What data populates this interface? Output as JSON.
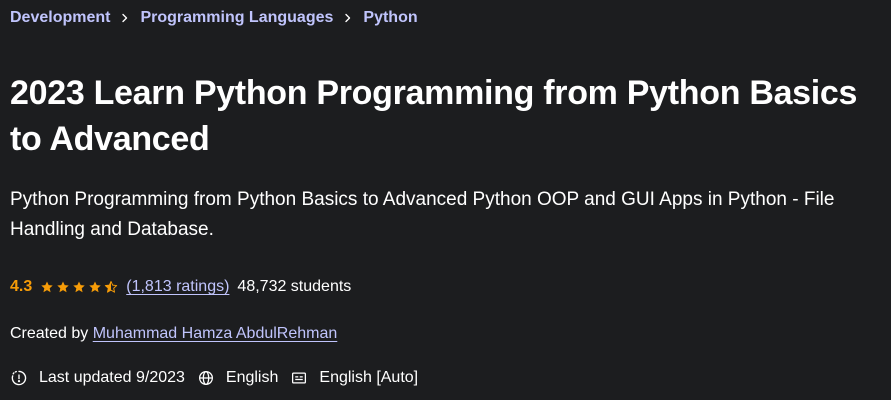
{
  "breadcrumb": {
    "items": [
      {
        "label": "Development"
      },
      {
        "label": "Programming Languages"
      },
      {
        "label": "Python"
      }
    ]
  },
  "course": {
    "title": "2023 Learn Python Programming from Python Basics to Advanced",
    "subtitle": "Python Programming from Python Basics to Advanced Python OOP and GUI Apps in Python - File Handling and Database."
  },
  "rating": {
    "value": "4.3",
    "stars": 4.3,
    "ratings_count": "(1,813 ratings)",
    "students": "48,732 students"
  },
  "creator": {
    "prefix": "Created by",
    "name": "Muhammad Hamza AbdulRehman"
  },
  "meta": {
    "last_updated": "Last updated 9/2023",
    "language": "English",
    "captions": "English [Auto]"
  },
  "colors": {
    "background": "#1c1d1f",
    "link": "#c0c4fc",
    "rating": "#f69c08",
    "text": "#ffffff"
  },
  "icons": {
    "separator": "chevron-right-icon",
    "star": "star-icon",
    "half_star": "star-half-icon",
    "updated": "alert-badge-icon",
    "language": "globe-icon",
    "captions": "closed-captions-icon"
  }
}
